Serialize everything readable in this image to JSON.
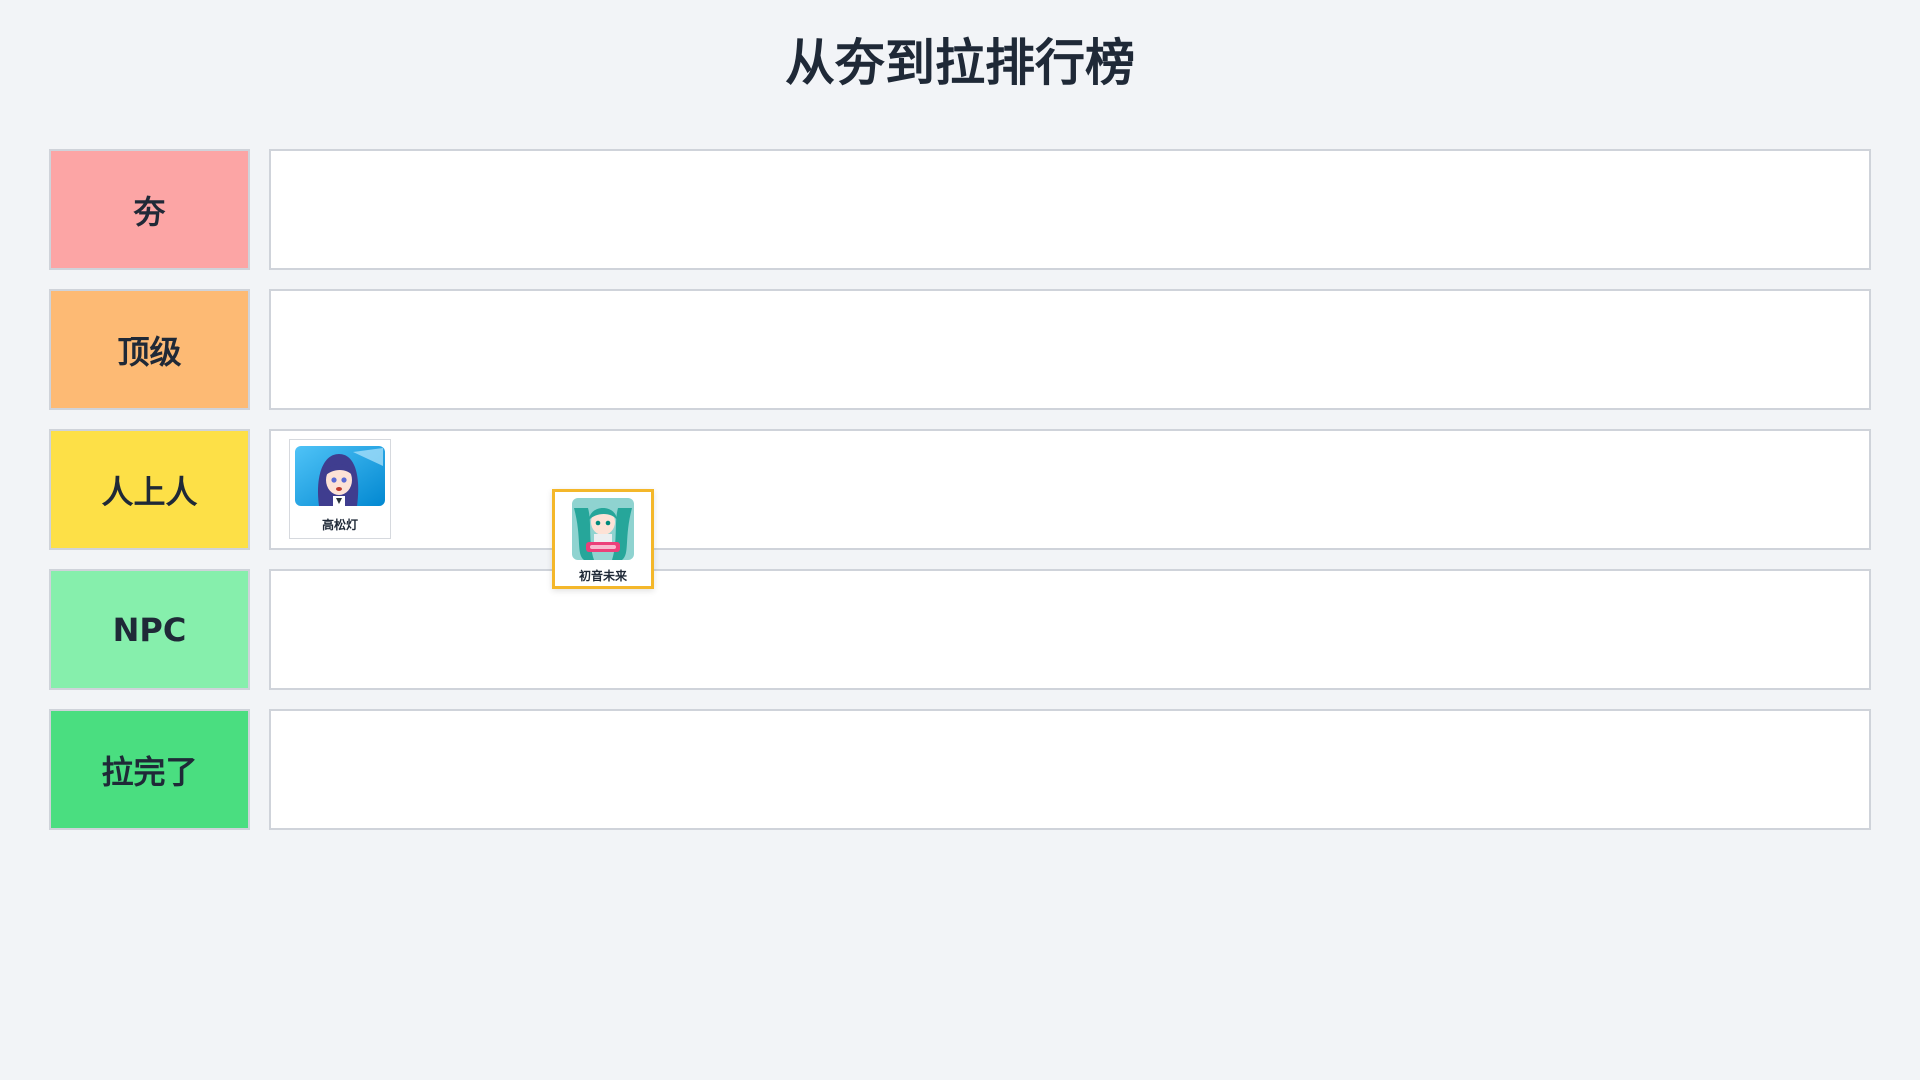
{
  "page": {
    "title": "从夯到拉排行榜"
  },
  "tiers": [
    {
      "label": "夯",
      "color": "#fca5a5"
    },
    {
      "label": "顶级",
      "color": "#fdba74"
    },
    {
      "label": "人上人",
      "color": "#fde047"
    },
    {
      "label": "NPC",
      "color": "#86efac"
    },
    {
      "label": "拉完了",
      "color": "#4ade80"
    }
  ],
  "items": [
    {
      "name": "高松灯",
      "tier": "人上人",
      "icon": "anime-girl-portrait"
    },
    {
      "name": "初音未来",
      "tier": "",
      "state": "dragging",
      "icon": "anime-girl-portrait"
    }
  ],
  "colors": {
    "drag_highlight": "#f4b72a",
    "background": "#f2f4f7"
  }
}
